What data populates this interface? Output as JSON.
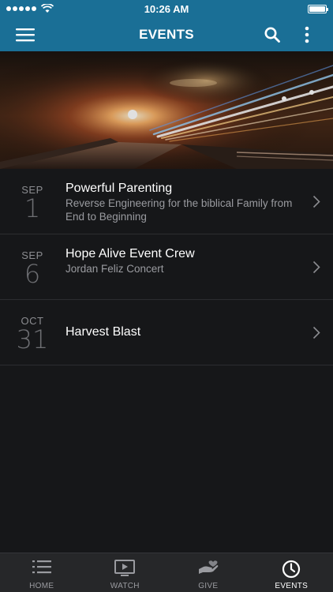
{
  "status_bar": {
    "time": "10:26 AM"
  },
  "header": {
    "title": "EVENTS"
  },
  "events": [
    {
      "month": "SEP",
      "day": "1",
      "title": "Powerful Parenting",
      "subtitle": "Reverse Engineering for the biblical Family from End to Beginning"
    },
    {
      "month": "SEP",
      "day": "6",
      "title": "Hope Alive Event Crew",
      "subtitle": "Jordan Feliz Concert"
    },
    {
      "month": "OCT",
      "day": "31",
      "title": "Harvest Blast",
      "subtitle": ""
    }
  ],
  "tabs": [
    {
      "label": "HOME",
      "icon": "list-icon",
      "active": false
    },
    {
      "label": "WATCH",
      "icon": "play-screen-icon",
      "active": false
    },
    {
      "label": "GIVE",
      "icon": "giving-hand-icon",
      "active": false
    },
    {
      "label": "EVENTS",
      "icon": "clock-icon",
      "active": true
    }
  ],
  "colors": {
    "header_bg": "#1a6f96",
    "page_bg": "#161719",
    "tab_bar_bg": "#262729",
    "active_tab": "#ffffff",
    "inactive_tab": "#9a9ba0"
  }
}
